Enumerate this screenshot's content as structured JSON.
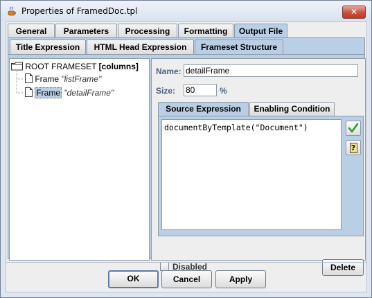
{
  "window": {
    "title": "Properties of FramedDoc.tpl",
    "close_glyph": "✕"
  },
  "top_tabs": [
    {
      "label": "General",
      "active": false
    },
    {
      "label": "Parameters",
      "active": false
    },
    {
      "label": "Processing",
      "active": false
    },
    {
      "label": "Formatting",
      "active": false
    },
    {
      "label": "Output File",
      "active": true
    }
  ],
  "sub_tabs": [
    {
      "label": "Title Expression",
      "active": false
    },
    {
      "label": "HTML Head Expression",
      "active": false
    },
    {
      "label": "Frameset Structure",
      "active": true
    }
  ],
  "tree": {
    "root": {
      "label": "ROOT FRAMESET",
      "tag": "[columns]"
    },
    "items": [
      {
        "label": "Frame",
        "name": "\"listFrame\"",
        "selected": false
      },
      {
        "label": "Frame",
        "name": "\"detailFrame\"",
        "selected": true
      }
    ]
  },
  "properties": {
    "name_label": "Name:",
    "name_value": "detailFrame",
    "size_label": "Size:",
    "size_value": "80",
    "size_unit": "%"
  },
  "expr_tabs": [
    {
      "label": "Source Expression",
      "active": true
    },
    {
      "label": "Enabling Condition",
      "active": false
    }
  ],
  "editor": {
    "text": "documentByTemplate(\"Document\")"
  },
  "side_buttons": {
    "check_icon": "check-icon",
    "help_icon": "help-icon",
    "help_glyph": "?"
  },
  "disabled_label": "Disabled",
  "delete_label": "Delete",
  "buttons": {
    "ok": "OK",
    "cancel": "Cancel",
    "apply": "Apply"
  },
  "colors": {
    "accent": "#b8cfe5",
    "check_green": "#2f9a2f",
    "label_blue": "#4a5f80"
  }
}
